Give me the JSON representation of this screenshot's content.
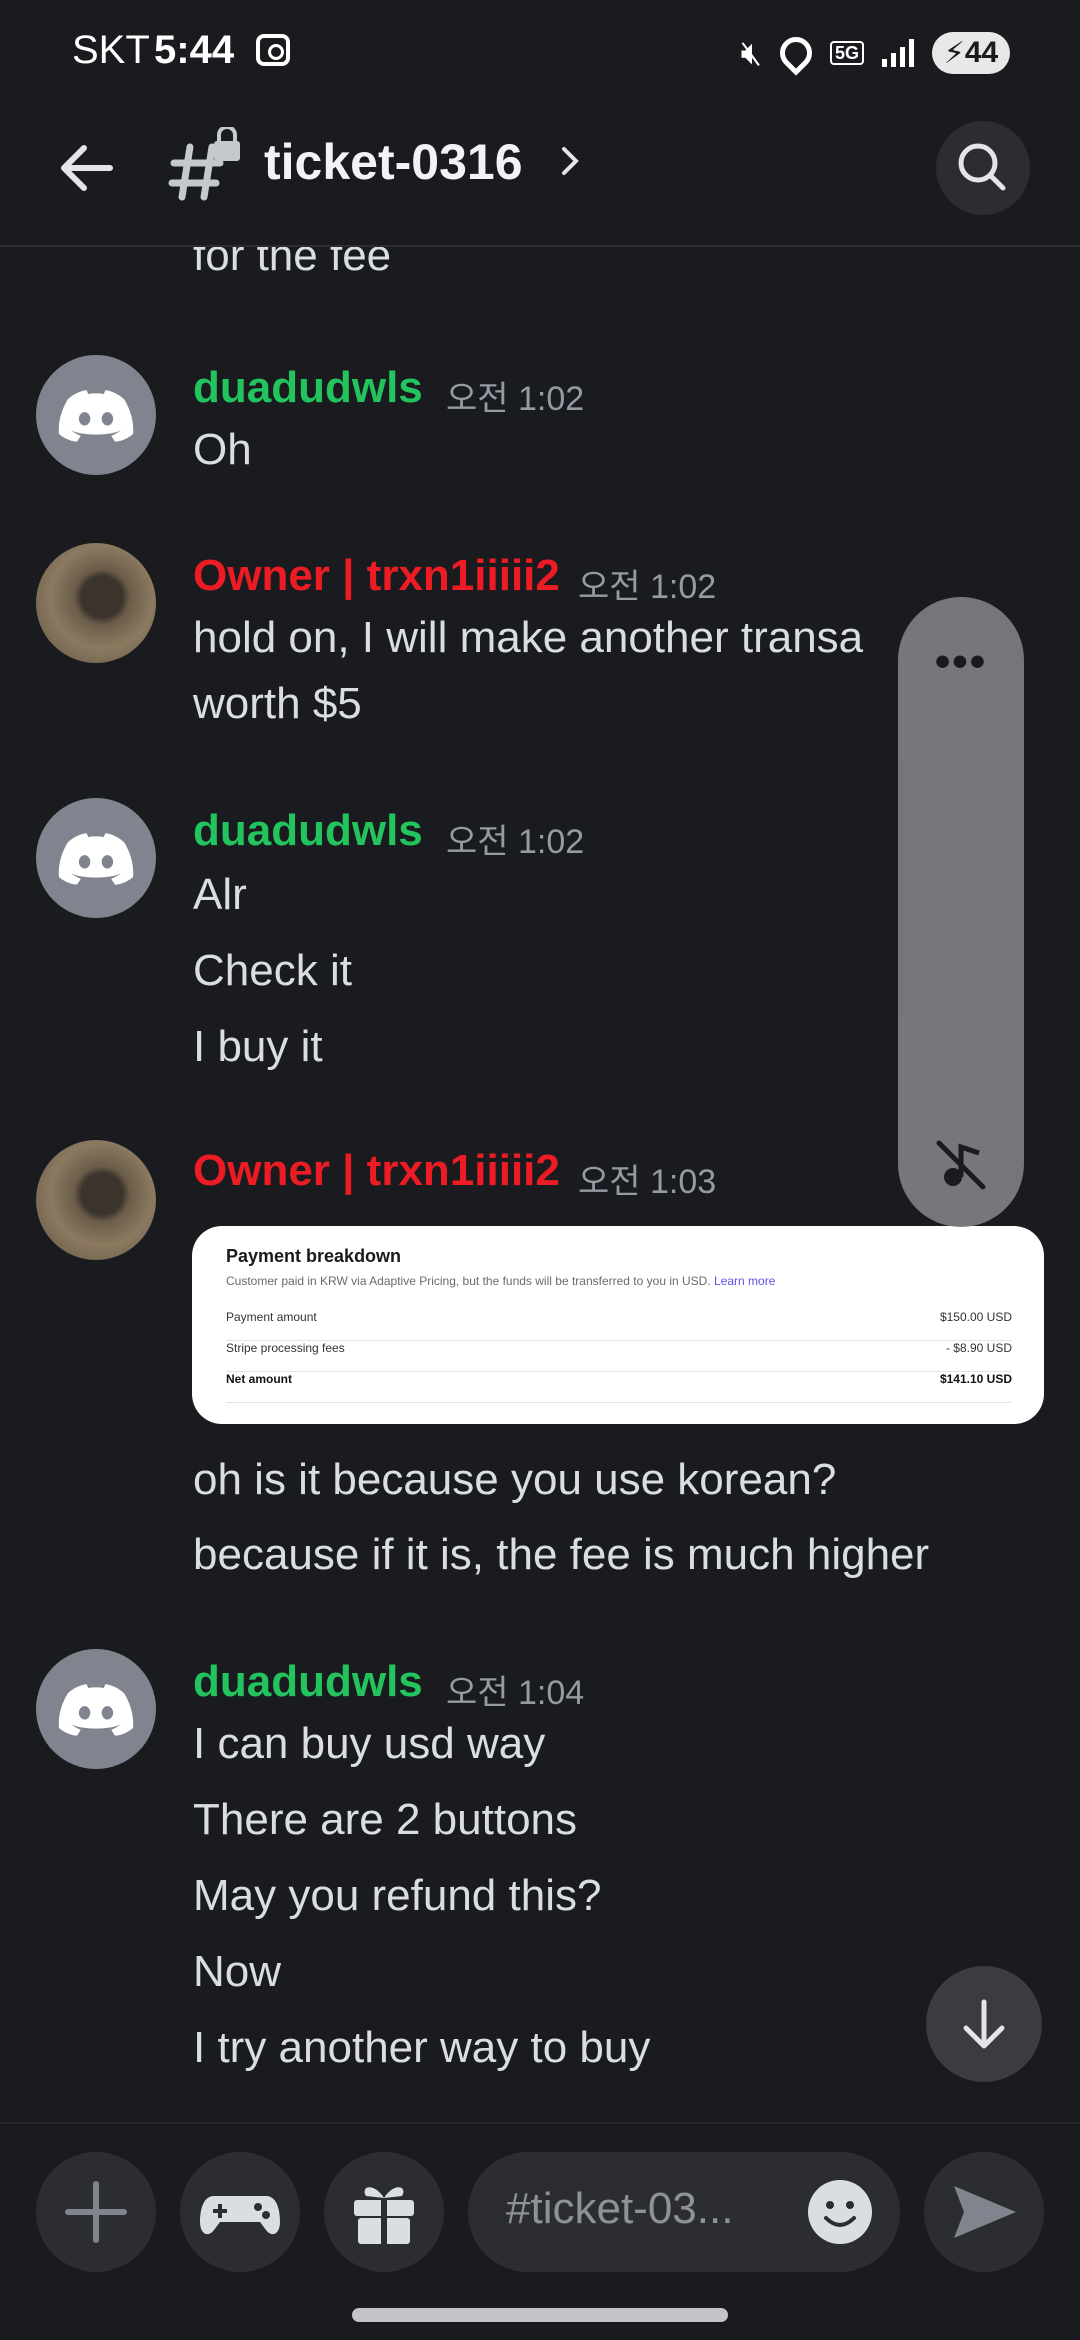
{
  "status_bar": {
    "carrier": "SKT",
    "time": "5:44",
    "network": "5G",
    "battery": "44"
  },
  "header": {
    "channel_name": "ticket-0316"
  },
  "messages": [
    {
      "lines": [
        "for the fee"
      ]
    },
    {
      "author": "duadudwls",
      "time": "오전 1:02",
      "lines": [
        "Oh"
      ]
    },
    {
      "author": "Owner | trxn1iiiii2",
      "time": "오전 1:02",
      "lines": [
        "hold on, I will make another transa",
        "worth $5"
      ]
    },
    {
      "author": "duadudwls",
      "time": "오전 1:02",
      "lines": [
        "Alr",
        "Check it",
        "I buy it"
      ]
    },
    {
      "author": "Owner | trxn1iiiii2",
      "time": "오전 1:03",
      "lines": [
        "oh is it because you use korean?",
        "because if it is, the fee is much higher"
      ]
    },
    {
      "author": "duadudwls",
      "time": "오전 1:04",
      "lines": [
        "I can buy usd way",
        "There are 2 buttons",
        "May you refund this?",
        "Now",
        "I try another way to buy"
      ]
    }
  ],
  "attachment": {
    "title": "Payment breakdown",
    "subtitle": "Customer paid in KRW via Adaptive Pricing, but the funds will be transferred to you in USD.",
    "link": "Learn more",
    "rows": [
      {
        "label": "Payment amount",
        "value": "$150.00 USD"
      },
      {
        "label": "Stripe processing fees",
        "value": "- $8.90 USD"
      },
      {
        "label": "Net amount",
        "value": "$141.10 USD"
      }
    ]
  },
  "composer": {
    "placeholder": "#ticket-03..."
  },
  "colors": {
    "background": "#1a1b1f",
    "user_green": "#23c45e",
    "owner_red": "#ed1c24",
    "timestamp": "#949ba4"
  }
}
